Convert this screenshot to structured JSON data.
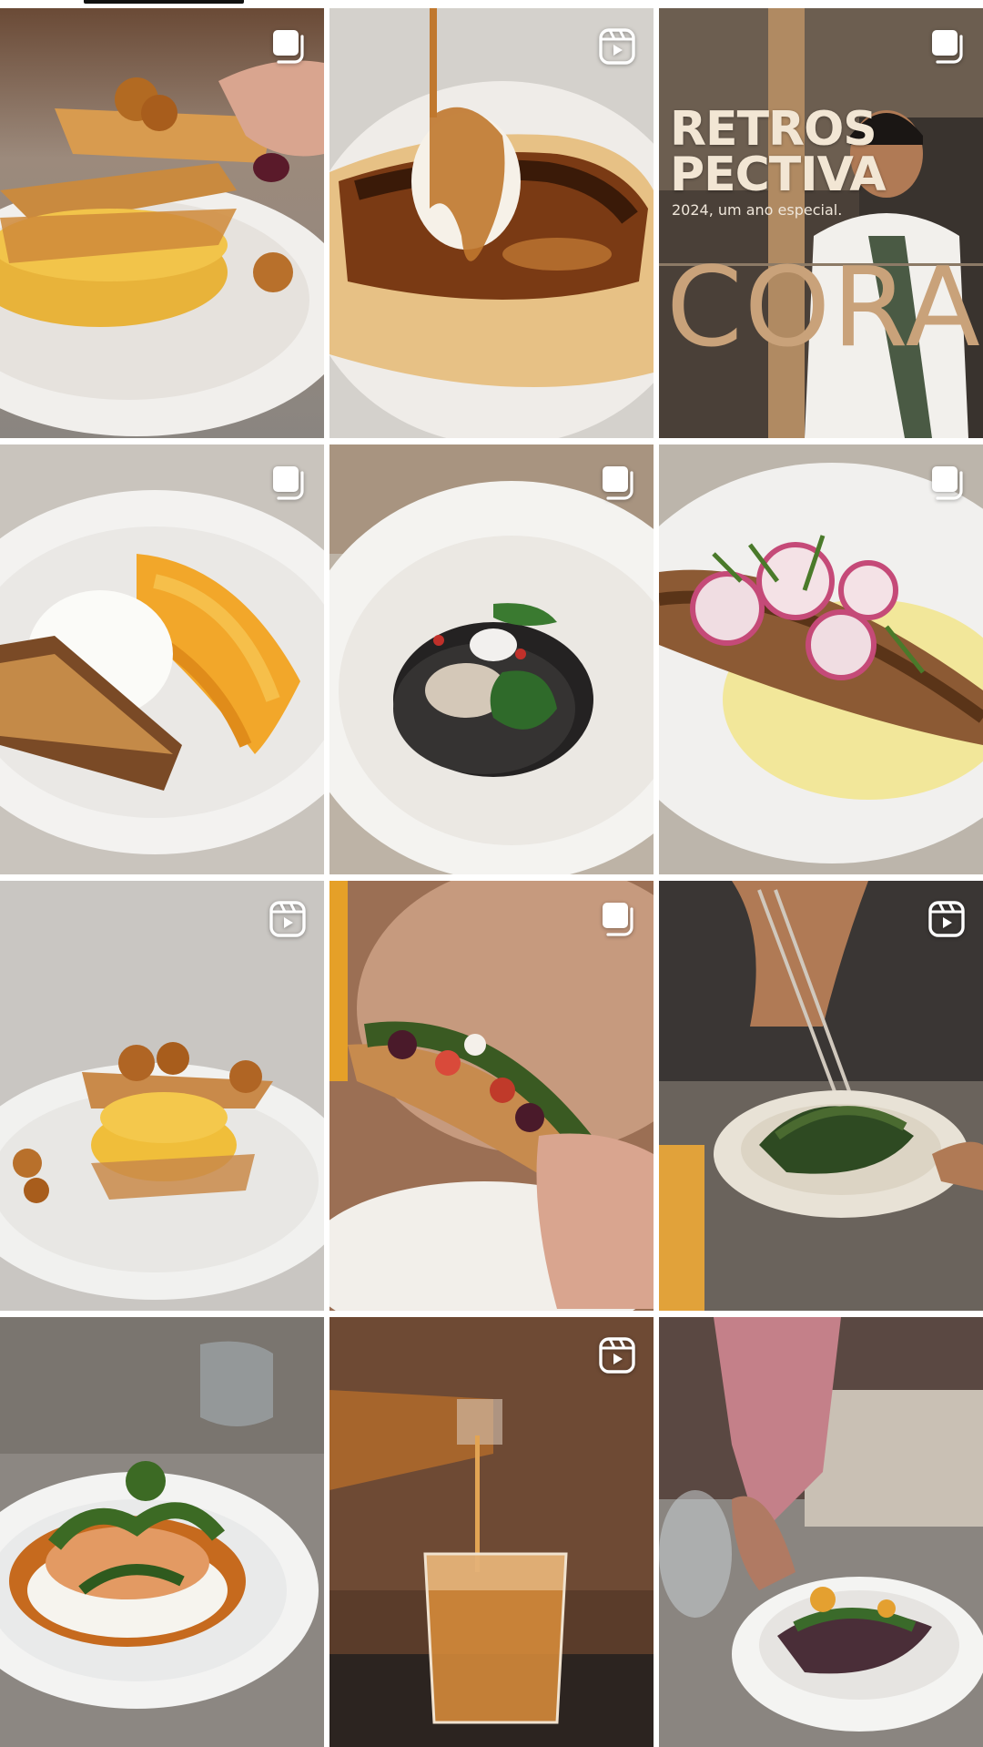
{
  "profile_tabs": {
    "active_tab_indicator": "posts-grid"
  },
  "grid": {
    "posts": [
      {
        "index": 1,
        "type": "carousel",
        "badge_icon": "carousel-icon"
      },
      {
        "index": 2,
        "type": "reel",
        "badge_icon": "reel-icon"
      },
      {
        "index": 3,
        "type": "carousel",
        "badge_icon": "carousel-icon",
        "overlay": {
          "title": "RETROS\nPECTIVA",
          "subtitle": "2024, um ano especial.",
          "brand": "CORA"
        }
      },
      {
        "index": 4,
        "type": "carousel",
        "badge_icon": "carousel-icon"
      },
      {
        "index": 5,
        "type": "carousel",
        "badge_icon": "carousel-icon"
      },
      {
        "index": 6,
        "type": "carousel",
        "badge_icon": "carousel-icon"
      },
      {
        "index": 7,
        "type": "reel",
        "badge_icon": "reel-icon"
      },
      {
        "index": 8,
        "type": "carousel",
        "badge_icon": "carousel-icon"
      },
      {
        "index": 9,
        "type": "reel",
        "badge_icon": "reel-icon"
      },
      {
        "index": 10,
        "type": "none"
      },
      {
        "index": 11,
        "type": "reel",
        "badge_icon": "reel-icon"
      },
      {
        "index": 12,
        "type": "none"
      }
    ]
  },
  "colors": {
    "indicator": "#111111",
    "badge": "#ffffff",
    "cover_brand": "#c9a27a"
  }
}
